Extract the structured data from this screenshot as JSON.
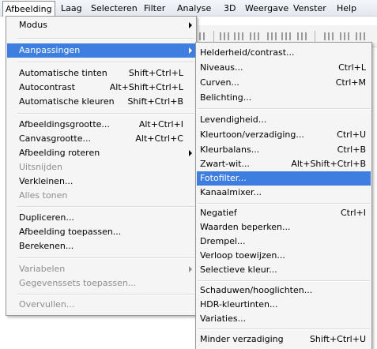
{
  "menubar": {
    "items": [
      {
        "label": "Afbeelding"
      },
      {
        "label": "Laag"
      },
      {
        "label": "Selecteren"
      },
      {
        "label": "Filter"
      },
      {
        "label": "Analyse"
      },
      {
        "label": "3D"
      },
      {
        "label": "Weergave"
      },
      {
        "label": "Venster"
      },
      {
        "label": "Help"
      }
    ]
  },
  "main_menu": {
    "items": [
      {
        "label": "Modus",
        "shortcut": "",
        "submenu": true
      },
      {
        "label": "Aanpassingen",
        "shortcut": "",
        "submenu": true,
        "highlighted": true
      },
      {
        "label": "Automatische tinten",
        "shortcut": "Shift+Ctrl+L"
      },
      {
        "label": "Autocontrast",
        "shortcut": "Alt+Shift+Ctrl+L"
      },
      {
        "label": "Automatische kleuren",
        "shortcut": "Shift+Ctrl+B"
      },
      {
        "label": "Afbeeldingsgrootte...",
        "shortcut": "Alt+Ctrl+I"
      },
      {
        "label": "Canvasgrootte...",
        "shortcut": "Alt+Ctrl+C"
      },
      {
        "label": "Afbeelding roteren",
        "shortcut": "",
        "submenu": true
      },
      {
        "label": "Uitsnijden",
        "shortcut": "",
        "disabled": true
      },
      {
        "label": "Verkleinen...",
        "shortcut": ""
      },
      {
        "label": "Alles tonen",
        "shortcut": "",
        "disabled": true
      },
      {
        "label": "Dupliceren...",
        "shortcut": ""
      },
      {
        "label": "Afbeelding toepassen...",
        "shortcut": ""
      },
      {
        "label": "Berekenen...",
        "shortcut": ""
      },
      {
        "label": "Variabelen",
        "shortcut": "",
        "submenu": true,
        "disabled": true
      },
      {
        "label": "Gegevenssets toepassen...",
        "shortcut": "",
        "disabled": true
      },
      {
        "label": "Overvullen...",
        "shortcut": "",
        "disabled": true
      }
    ]
  },
  "sub_menu": {
    "items": [
      {
        "label": "Helderheid/contrast...",
        "shortcut": ""
      },
      {
        "label": "Niveaus...",
        "shortcut": "Ctrl+L"
      },
      {
        "label": "Curven...",
        "shortcut": "Ctrl+M"
      },
      {
        "label": "Belichting...",
        "shortcut": ""
      },
      {
        "label": "Levendigheid...",
        "shortcut": ""
      },
      {
        "label": "Kleurtoon/verzadiging...",
        "shortcut": "Ctrl+U"
      },
      {
        "label": "Kleurbalans...",
        "shortcut": "Ctrl+B"
      },
      {
        "label": "Zwart-wit...",
        "shortcut": "Alt+Shift+Ctrl+B"
      },
      {
        "label": "Fotofilter...",
        "shortcut": "",
        "highlighted": true
      },
      {
        "label": "Kanaalmixer...",
        "shortcut": ""
      },
      {
        "label": "Negatief",
        "shortcut": "Ctrl+I"
      },
      {
        "label": "Waarden beperken...",
        "shortcut": ""
      },
      {
        "label": "Drempel...",
        "shortcut": ""
      },
      {
        "label": "Verloop toewijzen...",
        "shortcut": ""
      },
      {
        "label": "Selectieve kleur...",
        "shortcut": ""
      },
      {
        "label": "Schaduwen/hooglichten...",
        "shortcut": ""
      },
      {
        "label": "HDR-kleurtinten...",
        "shortcut": ""
      },
      {
        "label": "Variaties...",
        "shortcut": ""
      },
      {
        "label": "Minder verzadiging",
        "shortcut": "Shift+Ctrl+U"
      }
    ]
  },
  "colors": {
    "highlight": "#3d7ee0",
    "menu_bg": "#f5f5f5",
    "disabled_text": "#8e8e8e"
  }
}
